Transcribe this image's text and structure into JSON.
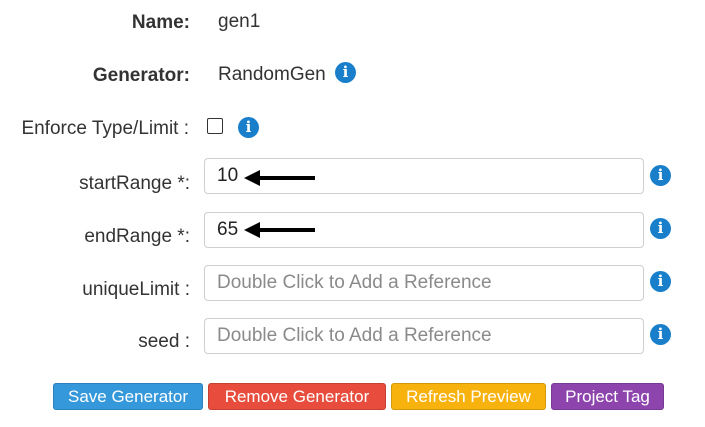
{
  "name_row": {
    "label": "Name:",
    "value": "gen1"
  },
  "generator_row": {
    "label": "Generator:",
    "value": "RandomGen"
  },
  "enforce_row": {
    "label": "Enforce Type/Limit :",
    "checked": false
  },
  "fields": [
    {
      "label": "startRange *:",
      "value": "10",
      "placeholder": ""
    },
    {
      "label": "endRange *:",
      "value": "65",
      "placeholder": ""
    },
    {
      "label": "uniqueLimit :",
      "value": "",
      "placeholder": "Double Click to Add a Reference"
    },
    {
      "label": "seed :",
      "value": "",
      "placeholder": "Double Click to Add a Reference"
    }
  ],
  "info_icon": "i",
  "buttons": {
    "save": {
      "label": "Save Generator",
      "color": "#3498db"
    },
    "remove": {
      "label": "Remove Generator",
      "color": "#e74c3c"
    },
    "refresh": {
      "label": "Refresh Preview",
      "color": "#f8b20e"
    },
    "tag": {
      "label": "Project Tag",
      "color": "#8e44ad"
    }
  }
}
